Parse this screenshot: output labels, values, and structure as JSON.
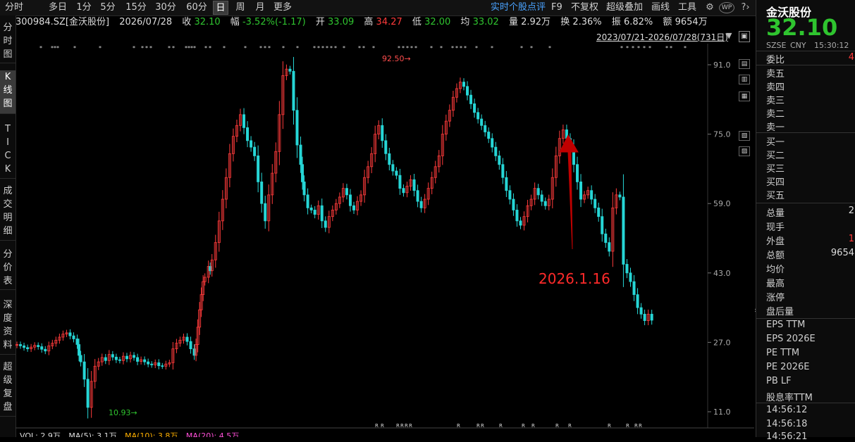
{
  "toolbar": {
    "periods": [
      "分时",
      "多日",
      "1分",
      "5分",
      "15分",
      "30分",
      "60分",
      "日",
      "周",
      "月",
      "更多"
    ],
    "active_period": "日",
    "realtime_review": "实时个股点评",
    "f9": "F9",
    "no_adjust": "不复权",
    "overlay": "超级叠加",
    "draw": "画线",
    "tools": "工具",
    "wp": "WP"
  },
  "info": {
    "code": "300984.SZ[金沃股份]",
    "date": "2026/07/28",
    "close_label": "收",
    "close": "32.10",
    "range_label": "幅",
    "range": "-3.52%(-1.17)",
    "open_label": "开",
    "open": "33.09",
    "high_label": "高",
    "high": "34.27",
    "low_label": "低",
    "low": "32.00",
    "avg_label": "均",
    "avg": "33.02",
    "vol_label": "量",
    "vol": "2.92万",
    "turnover_label": "换",
    "turnover": "2.36%",
    "amp_label": "振",
    "amp": "6.82%",
    "amount_label": "额",
    "amount": "9654万"
  },
  "date_range": "2023/07/21-2026/07/28(731日)",
  "left_tabs": [
    "分时图",
    "K线图",
    "TICK",
    "成交明细",
    "分价表",
    "深度资料",
    "超级复盘"
  ],
  "active_left_tab": "K线图",
  "chart_data": {
    "type": "candlestick",
    "y_axis_ticks": [
      91.0,
      75.0,
      59.0,
      43.0,
      27.0,
      11.0
    ],
    "ylim": [
      8,
      96
    ],
    "high_label": "92.50",
    "low_label": "10.93",
    "annotation": "2026.1.16",
    "x": [
      0,
      10,
      20,
      30,
      40,
      50,
      60,
      70,
      80,
      90,
      100,
      110,
      120,
      130,
      140,
      150,
      160,
      170,
      175,
      180,
      190,
      200,
      210,
      220,
      230,
      240,
      250,
      260,
      270,
      280,
      290,
      300,
      310,
      320,
      330,
      340,
      350,
      360,
      370,
      380,
      390,
      400,
      410,
      420,
      430,
      440,
      450,
      460,
      470,
      480,
      490,
      500,
      505,
      510,
      515,
      520,
      525,
      530,
      540,
      545,
      550,
      560,
      570,
      580,
      590,
      600,
      610,
      620,
      630,
      640,
      650,
      660,
      670,
      680,
      690,
      700,
      710,
      720,
      730,
      740,
      750,
      760,
      770,
      780,
      790,
      800,
      805,
      810,
      820,
      830,
      840,
      850,
      860,
      870,
      880,
      890,
      900,
      910,
      920,
      930,
      940,
      950,
      960,
      970,
      980,
      990,
      1000,
      1010,
      1020,
      1030,
      1040,
      1050,
      1060,
      1070,
      1080,
      1090,
      1100,
      1110,
      1120,
      1130,
      1140,
      1150,
      1160,
      1170,
      1180,
      1190,
      1200,
      1210,
      1220,
      1230,
      1240,
      1250,
      1260,
      1270,
      1280,
      1290,
      1300,
      1310,
      1320,
      1330,
      1340,
      1350,
      1360,
      1370,
      1380,
      1390,
      1400,
      1410,
      1420,
      1430,
      1440,
      1450,
      1460,
      1470,
      1480,
      1490,
      1500,
      1510,
      1520,
      1530,
      1540,
      1550,
      1560,
      1570,
      1580,
      1590,
      1600,
      1610,
      1620,
      1630,
      1640,
      1650,
      1660,
      1670,
      1680,
      1690,
      1700,
      1710,
      1720,
      1730,
      1740,
      1750,
      1760,
      1770,
      1780,
      1790,
      1800,
      1810,
      1820,
      1830,
      1840,
      1850,
      1860,
      1870,
      1880,
      1890
    ],
    "close": [
      26.5,
      26.2,
      25.8,
      25.5,
      25.9,
      26.3,
      26.0,
      25.4,
      25.0,
      26.2,
      26.8,
      27.5,
      28.2,
      28.9,
      29.2,
      28.5,
      27.8,
      26.5,
      24.0,
      22.5,
      18.5,
      12.0,
      18.0,
      21.5,
      22.5,
      23.5,
      22.8,
      24.2,
      23.6,
      23.0,
      22.8,
      23.8,
      23.2,
      24.0,
      23.5,
      22.6,
      23.0,
      22.5,
      22.0,
      21.8,
      22.3,
      21.6,
      21.5,
      22.0,
      22.3,
      25.5,
      26.8,
      27.5,
      28.2,
      27.2,
      25.5,
      24.0,
      26.5,
      30.5,
      34.5,
      38.0,
      41.0,
      42.0,
      44.5,
      43.5,
      46.0,
      50.0,
      55.0,
      60.0,
      65.0,
      70.5,
      74.5,
      77.0,
      79.5,
      76.5,
      73.5,
      72.0,
      70.0,
      64.0,
      59.0,
      55.0,
      61.0,
      66.0,
      71.0,
      79.5,
      88.5,
      90.0,
      89.5,
      80.5,
      72.5,
      68.0,
      64.0,
      61.0,
      58.0,
      57.5,
      56.5,
      58.5,
      55.0,
      53.5,
      56.0,
      57.5,
      59.0,
      60.5,
      62.5,
      61.0,
      58.5,
      57.5,
      59.5,
      61.0,
      65.0,
      67.5,
      70.5,
      75.0,
      77.0,
      73.5,
      70.5,
      68.0,
      66.5,
      65.5,
      62.5,
      61.5,
      63.0,
      64.5,
      62.0,
      59.5,
      58.0,
      60.0,
      62.5,
      65.0,
      67.5,
      70.0,
      75.0,
      78.0,
      80.5,
      83.5,
      85.5,
      87.0,
      86.0,
      84.0,
      82.0,
      80.0,
      78.5,
      77.0,
      75.5,
      74.0,
      72.0,
      70.0,
      68.0,
      65.0,
      62.0,
      60.0,
      57.5,
      55.0,
      54.0,
      56.0,
      58.5,
      60.0,
      62.5,
      61.0,
      59.5,
      58.5,
      60.0,
      65.0,
      70.0,
      74.0,
      76.0,
      74.0,
      72.0,
      68.0,
      64.0,
      60.0,
      61.0,
      62.0,
      60.0,
      58.0,
      56.0,
      52.0,
      50.0,
      48.0,
      58.0,
      61.0,
      60.5,
      45.0,
      43.0,
      41.0,
      38.0,
      35.0,
      33.5,
      32.0,
      33.5,
      32.1
    ]
  },
  "vol_bar": {
    "prefix": "VOL: 2.9万",
    "ma5": "MA(5): 3.1万",
    "ma10": "MA(10): 3.8万",
    "ma20": "MA(20): 4.5万"
  },
  "right_panel": {
    "name": "金沃股份",
    "price": "32.10",
    "exchange": "SZSE",
    "currency": "CNY",
    "time": "15:30:12",
    "committee": "委比",
    "asks": [
      "卖五",
      "卖四",
      "卖三",
      "卖二",
      "卖一"
    ],
    "bids": [
      "买一",
      "买二",
      "买三",
      "买四",
      "买五"
    ],
    "stats": [
      {
        "label": "总量",
        "value": "2"
      },
      {
        "label": "现手",
        "value": ""
      },
      {
        "label": "外盘",
        "value": "1"
      },
      {
        "label": "总额",
        "value": "9654"
      },
      {
        "label": "均价",
        "value": ""
      },
      {
        "label": "最高",
        "value": ""
      },
      {
        "label": "涨停",
        "value": ""
      },
      {
        "label": "盘后量",
        "value": ""
      }
    ],
    "ratios": [
      "EPS TTM",
      "EPS 2026E",
      "PE TTM",
      "PE 2026E",
      "PB LF",
      "股息率TTM"
    ],
    "ticks": [
      "14:56:12",
      "14:56:18",
      "14:56:21"
    ]
  },
  "colors": {
    "up": "#ff3b3b",
    "down": "#26d6d6",
    "accent": "#4aa3ff",
    "price_green": "#2fc42f"
  }
}
